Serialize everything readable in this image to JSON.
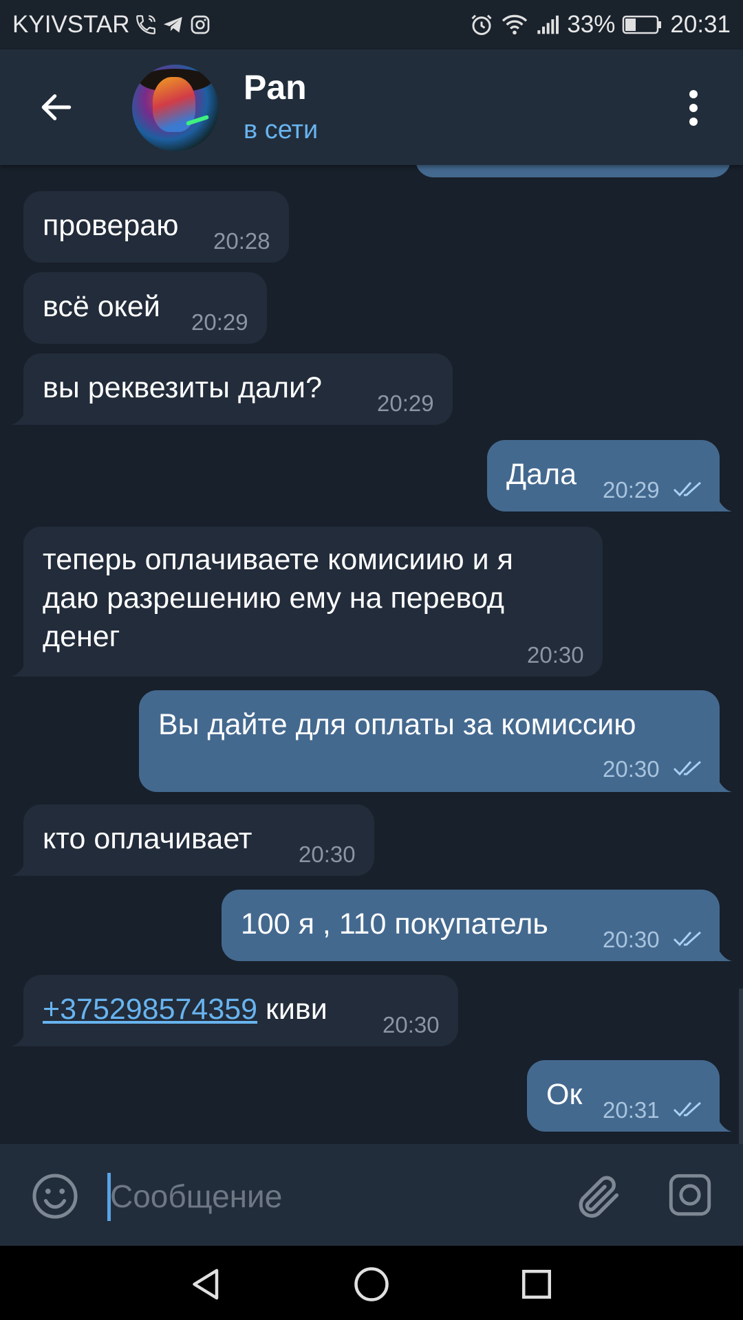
{
  "status_bar": {
    "carrier": "KYIVSTAR",
    "battery_percent": "33%",
    "battery_level": 0.33,
    "time": "20:31",
    "icons": [
      "phone-icon",
      "telegram-icon",
      "instagram-icon",
      "alarm-icon",
      "wifi-icon",
      "signal-icon",
      "battery-icon"
    ]
  },
  "header": {
    "back_icon": "arrow-left-icon",
    "contact_name": "Pan",
    "contact_status": "в сети",
    "menu_icon": "more-vertical-icon"
  },
  "messages": [
    {
      "direction": "in",
      "text": "провераю",
      "time": "20:28"
    },
    {
      "direction": "in",
      "text": "всё окей",
      "time": "20:29"
    },
    {
      "direction": "in",
      "text": "вы реквезиты дали?",
      "time": "20:29"
    },
    {
      "direction": "out",
      "text": "Дала",
      "time": "20:29",
      "read": true
    },
    {
      "direction": "in",
      "lines": [
        "теперь оплачиваете комисиию и я",
        "даю разрешению ему на перевод",
        "денег"
      ],
      "time": "20:30"
    },
    {
      "direction": "out",
      "text": "Вы дайте для оплаты за комиссию",
      "time": "20:30",
      "read": true
    },
    {
      "direction": "in",
      "text": "кто оплачивает",
      "time": "20:30"
    },
    {
      "direction": "out",
      "text": "100 я , 110 покупатель",
      "time": "20:30",
      "read": true
    },
    {
      "direction": "in",
      "link": "+375298574359",
      "text": " киви",
      "time": "20:30"
    },
    {
      "direction": "out",
      "text": "Ок",
      "time": "20:31",
      "read": true
    }
  ],
  "composer": {
    "placeholder": "Сообщение",
    "emoji_icon": "smiley-icon",
    "attach_icon": "paperclip-icon",
    "camera_icon": "camera-icon"
  },
  "navbar": {
    "icons": [
      "nav-back-icon",
      "nav-home-icon",
      "nav-recents-icon"
    ]
  },
  "colors": {
    "chat_background": "#18202b",
    "header_background": "#222d3b",
    "incoming_bubble": "#222c3a",
    "outgoing_bubble": "#44698f",
    "accent": "#68b4f0"
  }
}
